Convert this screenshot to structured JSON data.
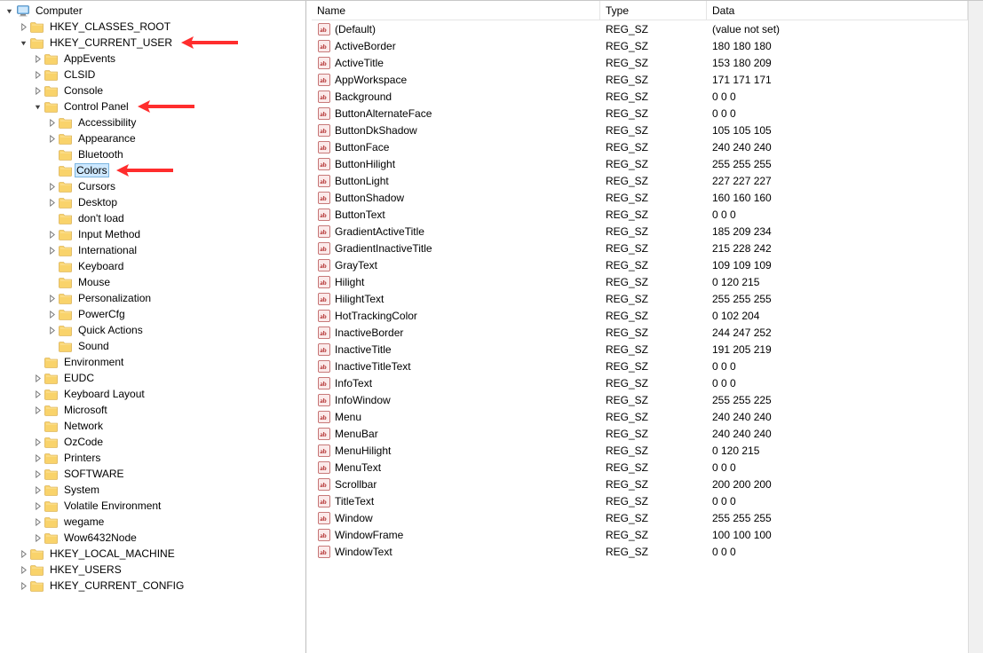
{
  "columns": {
    "name": "Name",
    "type": "Type",
    "data": "Data"
  },
  "tree": [
    {
      "label": "Computer",
      "icon": "computer",
      "expanded": true,
      "level": 0,
      "children": [
        {
          "label": "HKEY_CLASSES_ROOT",
          "icon": "folder",
          "level": 1,
          "expandable": true
        },
        {
          "label": "HKEY_CURRENT_USER",
          "icon": "folder",
          "level": 1,
          "expanded": true,
          "arrow": true,
          "children": [
            {
              "label": "AppEvents",
              "icon": "folder",
              "level": 2,
              "expandable": true
            },
            {
              "label": "CLSID",
              "icon": "folder",
              "level": 2,
              "expandable": true
            },
            {
              "label": "Console",
              "icon": "folder",
              "level": 2,
              "expandable": true
            },
            {
              "label": "Control Panel",
              "icon": "folder",
              "level": 2,
              "expanded": true,
              "arrow": true,
              "children": [
                {
                  "label": "Accessibility",
                  "icon": "folder",
                  "level": 3,
                  "expandable": true
                },
                {
                  "label": "Appearance",
                  "icon": "folder",
                  "level": 3,
                  "expandable": true
                },
                {
                  "label": "Bluetooth",
                  "icon": "folder",
                  "level": 3
                },
                {
                  "label": "Colors",
                  "icon": "folder",
                  "level": 3,
                  "selected": true,
                  "arrow": true
                },
                {
                  "label": "Cursors",
                  "icon": "folder",
                  "level": 3,
                  "expandable": true
                },
                {
                  "label": "Desktop",
                  "icon": "folder",
                  "level": 3,
                  "expandable": true
                },
                {
                  "label": "don't load",
                  "icon": "folder",
                  "level": 3
                },
                {
                  "label": "Input Method",
                  "icon": "folder",
                  "level": 3,
                  "expandable": true
                },
                {
                  "label": "International",
                  "icon": "folder",
                  "level": 3,
                  "expandable": true
                },
                {
                  "label": "Keyboard",
                  "icon": "folder",
                  "level": 3
                },
                {
                  "label": "Mouse",
                  "icon": "folder",
                  "level": 3
                },
                {
                  "label": "Personalization",
                  "icon": "folder",
                  "level": 3,
                  "expandable": true
                },
                {
                  "label": "PowerCfg",
                  "icon": "folder",
                  "level": 3,
                  "expandable": true
                },
                {
                  "label": "Quick Actions",
                  "icon": "folder",
                  "level": 3,
                  "expandable": true
                },
                {
                  "label": "Sound",
                  "icon": "folder",
                  "level": 3
                }
              ]
            },
            {
              "label": "Environment",
              "icon": "folder",
              "level": 2
            },
            {
              "label": "EUDC",
              "icon": "folder",
              "level": 2,
              "expandable": true
            },
            {
              "label": "Keyboard Layout",
              "icon": "folder",
              "level": 2,
              "expandable": true
            },
            {
              "label": "Microsoft",
              "icon": "folder",
              "level": 2,
              "expandable": true
            },
            {
              "label": "Network",
              "icon": "folder",
              "level": 2
            },
            {
              "label": "OzCode",
              "icon": "folder",
              "level": 2,
              "expandable": true
            },
            {
              "label": "Printers",
              "icon": "folder",
              "level": 2,
              "expandable": true
            },
            {
              "label": "SOFTWARE",
              "icon": "folder",
              "level": 2,
              "expandable": true
            },
            {
              "label": "System",
              "icon": "folder",
              "level": 2,
              "expandable": true
            },
            {
              "label": "Volatile Environment",
              "icon": "folder",
              "level": 2,
              "expandable": true
            },
            {
              "label": "wegame",
              "icon": "folder",
              "level": 2,
              "expandable": true
            },
            {
              "label": "Wow6432Node",
              "icon": "folder",
              "level": 2,
              "expandable": true
            }
          ]
        },
        {
          "label": "HKEY_LOCAL_MACHINE",
          "icon": "folder",
          "level": 1,
          "expandable": true
        },
        {
          "label": "HKEY_USERS",
          "icon": "folder",
          "level": 1,
          "expandable": true
        },
        {
          "label": "HKEY_CURRENT_CONFIG",
          "icon": "folder",
          "level": 1,
          "expandable": true
        }
      ]
    }
  ],
  "values": [
    {
      "name": "(Default)",
      "type": "REG_SZ",
      "data": "(value not set)"
    },
    {
      "name": "ActiveBorder",
      "type": "REG_SZ",
      "data": "180 180 180"
    },
    {
      "name": "ActiveTitle",
      "type": "REG_SZ",
      "data": "153 180 209"
    },
    {
      "name": "AppWorkspace",
      "type": "REG_SZ",
      "data": "171 171 171"
    },
    {
      "name": "Background",
      "type": "REG_SZ",
      "data": "0 0 0"
    },
    {
      "name": "ButtonAlternateFace",
      "type": "REG_SZ",
      "data": "0 0 0"
    },
    {
      "name": "ButtonDkShadow",
      "type": "REG_SZ",
      "data": "105 105 105"
    },
    {
      "name": "ButtonFace",
      "type": "REG_SZ",
      "data": "240 240 240"
    },
    {
      "name": "ButtonHilight",
      "type": "REG_SZ",
      "data": "255 255 255"
    },
    {
      "name": "ButtonLight",
      "type": "REG_SZ",
      "data": "227 227 227"
    },
    {
      "name": "ButtonShadow",
      "type": "REG_SZ",
      "data": "160 160 160"
    },
    {
      "name": "ButtonText",
      "type": "REG_SZ",
      "data": "0 0 0"
    },
    {
      "name": "GradientActiveTitle",
      "type": "REG_SZ",
      "data": "185 209 234"
    },
    {
      "name": "GradientInactiveTitle",
      "type": "REG_SZ",
      "data": "215 228 242"
    },
    {
      "name": "GrayText",
      "type": "REG_SZ",
      "data": "109 109 109"
    },
    {
      "name": "Hilight",
      "type": "REG_SZ",
      "data": "0 120 215"
    },
    {
      "name": "HilightText",
      "type": "REG_SZ",
      "data": "255 255 255"
    },
    {
      "name": "HotTrackingColor",
      "type": "REG_SZ",
      "data": "0 102 204"
    },
    {
      "name": "InactiveBorder",
      "type": "REG_SZ",
      "data": "244 247 252"
    },
    {
      "name": "InactiveTitle",
      "type": "REG_SZ",
      "data": "191 205 219"
    },
    {
      "name": "InactiveTitleText",
      "type": "REG_SZ",
      "data": "0 0 0"
    },
    {
      "name": "InfoText",
      "type": "REG_SZ",
      "data": "0 0 0"
    },
    {
      "name": "InfoWindow",
      "type": "REG_SZ",
      "data": "255 255 225"
    },
    {
      "name": "Menu",
      "type": "REG_SZ",
      "data": "240 240 240"
    },
    {
      "name": "MenuBar",
      "type": "REG_SZ",
      "data": "240 240 240"
    },
    {
      "name": "MenuHilight",
      "type": "REG_SZ",
      "data": "0 120 215"
    },
    {
      "name": "MenuText",
      "type": "REG_SZ",
      "data": "0 0 0"
    },
    {
      "name": "Scrollbar",
      "type": "REG_SZ",
      "data": "200 200 200"
    },
    {
      "name": "TitleText",
      "type": "REG_SZ",
      "data": "0 0 0"
    },
    {
      "name": "Window",
      "type": "REG_SZ",
      "data": "255 255 255"
    },
    {
      "name": "WindowFrame",
      "type": "REG_SZ",
      "data": "100 100 100"
    },
    {
      "name": "WindowText",
      "type": "REG_SZ",
      "data": "0 0 0"
    }
  ]
}
